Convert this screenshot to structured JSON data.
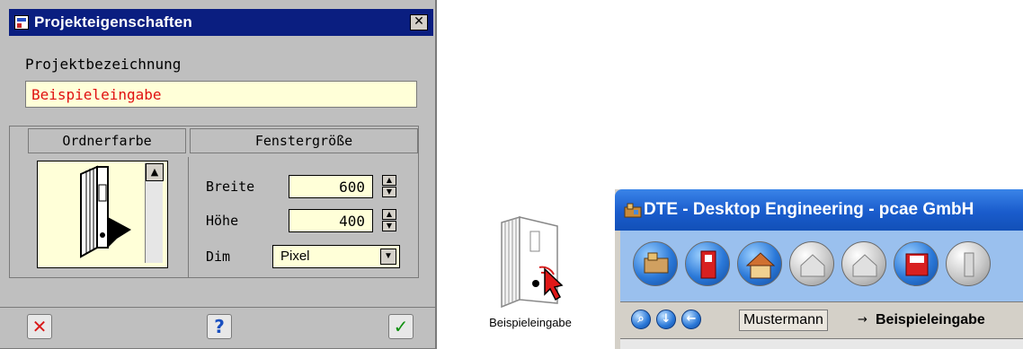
{
  "dialog": {
    "title": "Projekteigenschaften",
    "close_glyph": "✕",
    "project_label": "Projektbezeichnung",
    "project_value": "Beispieleingabe",
    "folder_color_header": "Ordnerfarbe",
    "window_size_header": "Fenstergröße",
    "width_label": "Breite",
    "width_value": "600",
    "height_label": "Höhe",
    "height_value": "400",
    "dim_label": "Dim",
    "dim_value": "Pixel",
    "buttons": {
      "cancel_glyph": "✕",
      "help_glyph": "?",
      "ok_glyph": "✓"
    }
  },
  "desktop_icon": {
    "label": "Beispieleingabe"
  },
  "dte_window": {
    "title": "DTE - Desktop Engineering - pcae GmbH",
    "breadcrumb_user": "Mustermann",
    "breadcrumb_arrow": "→",
    "breadcrumb_project": "Beispieleingabe"
  },
  "colors": {
    "dialog_bg": "#bfbfbf",
    "titlebar": "#0a1e80",
    "field_bg": "#ffffd8",
    "project_text": "#e01010",
    "dte_title": "#1a5ccc",
    "dte_toolbar": "#9ac0ee"
  },
  "icons": [
    "dialog-icon",
    "close-icon",
    "folder-icon",
    "cancel-icon",
    "help-icon",
    "ok-icon",
    "binder-icon",
    "cursor-icon",
    "dte-app-icon",
    "search-icon",
    "down-icon",
    "back-icon"
  ]
}
